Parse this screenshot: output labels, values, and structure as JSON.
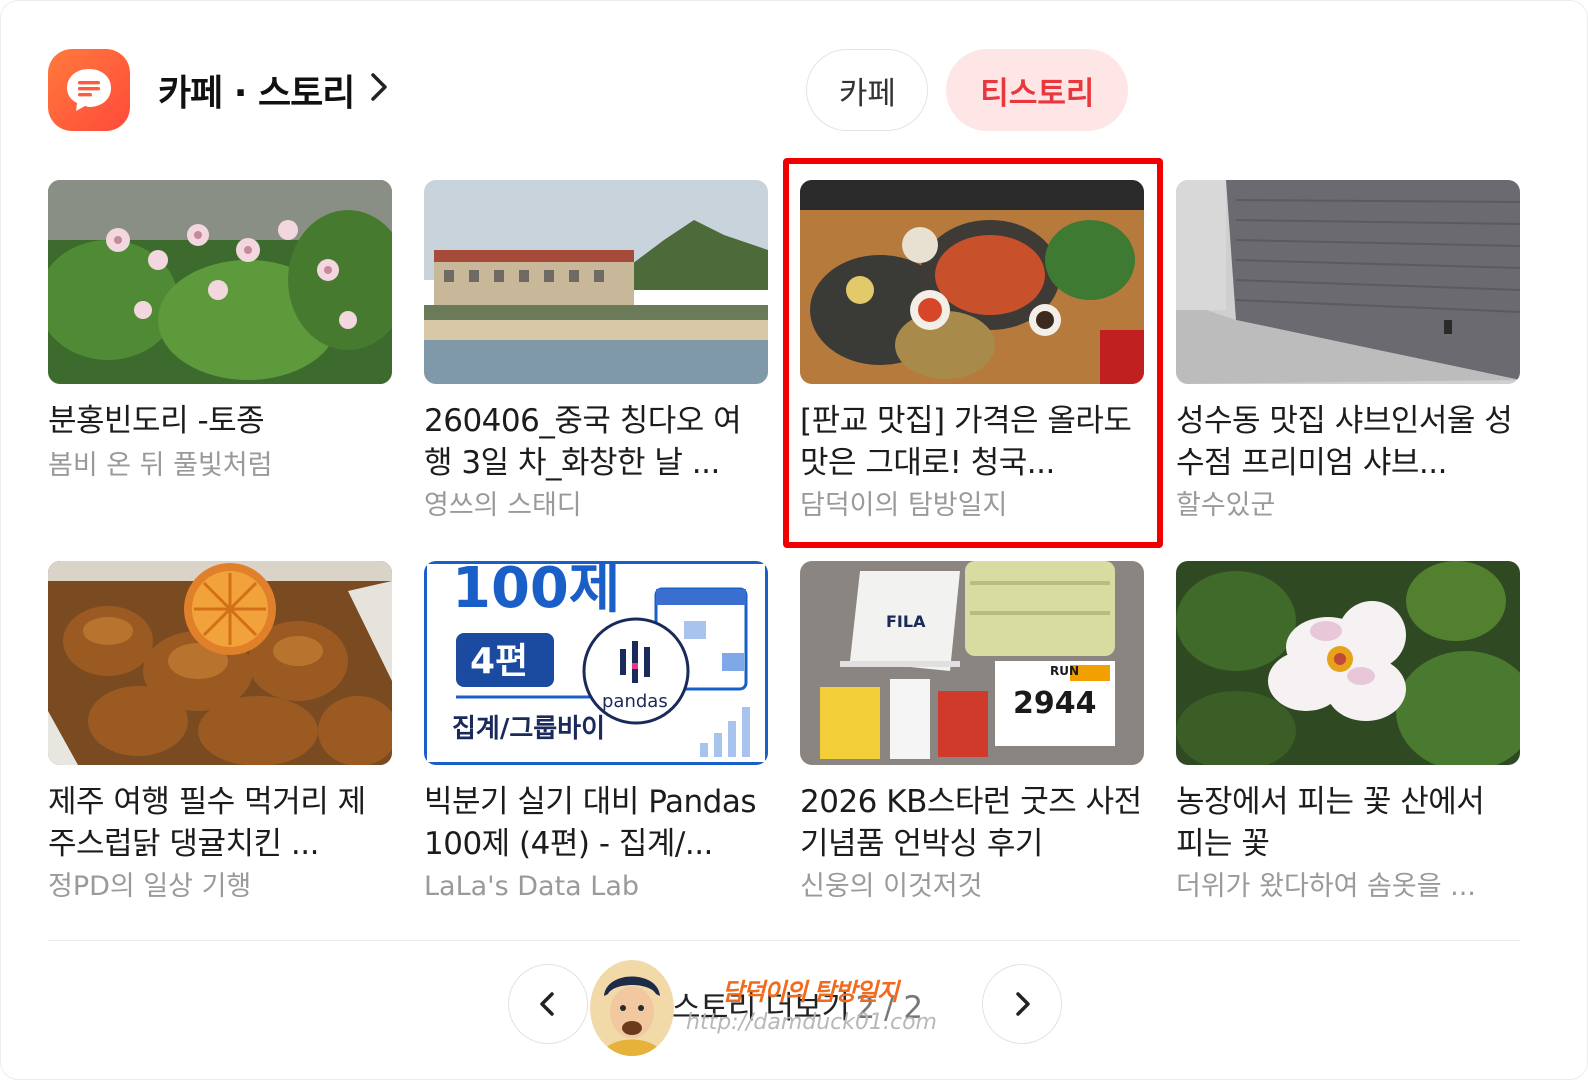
{
  "header": {
    "title": "카페 · 스토리",
    "tabs": [
      {
        "label": "카페",
        "active": false
      },
      {
        "label": "티스토리",
        "active": true
      }
    ]
  },
  "colors": {
    "accent": "#e8383d",
    "logo": "#ff5a3a",
    "highlight": "#f00000"
  },
  "cards": [
    {
      "title": "분홍빈도리 -토종",
      "subtitle": "봄비 온 뒤 풀빛처럼"
    },
    {
      "title": "260406_중국 칭다오 여행 3일 차_화창한 날 ...",
      "subtitle": "영쓰의 스태디"
    },
    {
      "title": "[판교 맛집] 가격은 올라도 맛은 그대로! 청국...",
      "subtitle": "담덕이의 탐방일지"
    },
    {
      "title": "성수동 맛집 샤브인서울 성수점 프리미엄 샤브...",
      "subtitle": "할수있군"
    },
    {
      "title": "제주 여행 필수 먹거리 제주스럽닭 댕귤치킨 ...",
      "subtitle": "정PD의 일상 기행"
    },
    {
      "title": "빅분기 실기 대비 Pandas 100제 (4편) - 집계/...",
      "subtitle": "LaLa's Data Lab",
      "thumb_text": {
        "big": "100제",
        "badge": "4편",
        "caption": "집계/그룹바이",
        "logo": "pandas"
      }
    },
    {
      "title": "2026 KB스타런 굿즈 사전 기념품 언박싱 후기",
      "subtitle": "신웅의 이것저것",
      "thumb_text": {
        "bib": "2944",
        "brand": "FILA",
        "race": "RUN"
      }
    },
    {
      "title": "농장에서 피는 꽃 산에서 피는 꽃",
      "subtitle": "더위가 왔다하여 솜옷을 ..."
    }
  ],
  "footer": {
    "more_label": "스토리 더보기",
    "page": "2 / 2",
    "watermark_name": "담덕이의 탐방일지",
    "watermark_url": "http://damduck01.com"
  }
}
